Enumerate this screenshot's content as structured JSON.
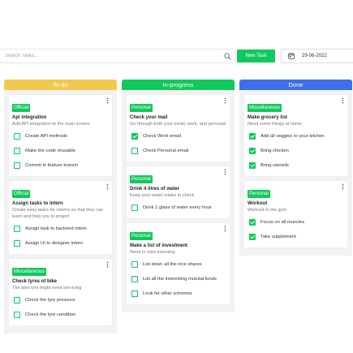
{
  "toolbar": {
    "search_placeholder": "Search Tasks...",
    "new_task_label": "New Task",
    "date_value": "29-06-2022"
  },
  "colors": {
    "todo": "#f2c94c",
    "inprogress": "#10c95a",
    "done": "#3d6fe8",
    "tag": "#10c95a"
  },
  "columns": [
    {
      "title": "To do",
      "cards": [
        {
          "tag": "Official",
          "title": "Api integration",
          "desc": "Add API integration to the main screen",
          "tasks": [
            {
              "label": "Create API methods",
              "checked": false
            },
            {
              "label": "Make the code reusable",
              "checked": false
            },
            {
              "label": "Commit in feature branch",
              "checked": false
            }
          ]
        },
        {
          "tag": "Official",
          "title": "Assign tasks to intern",
          "desc": "Create easy tasks for interns so that they can learn and help you in project",
          "tasks": [
            {
              "label": "Assign task to backend intern",
              "checked": false
            },
            {
              "label": "Assign UI to designer intern",
              "checked": false
            }
          ]
        },
        {
          "tag": "Miscellaneous",
          "title": "Check tyres of bike",
          "desc": "The bike tyre might need servicing",
          "tasks": [
            {
              "label": "Check the tyre pressure",
              "checked": false
            },
            {
              "label": "Check the tyre condition",
              "checked": false
            }
          ]
        }
      ]
    },
    {
      "title": "In-progress",
      "cards": [
        {
          "tag": "Personal",
          "title": "Check your mail",
          "desc": "Go through both your email, work, and personal",
          "tasks": [
            {
              "label": "Check Work email",
              "checked": true
            },
            {
              "label": "Check Personal email",
              "checked": false
            }
          ]
        },
        {
          "tag": "Personal",
          "title": "Drink 4 litres of water",
          "desc": "Keep your water intake in check",
          "tasks": [
            {
              "label": "Drink 1 glass of water every hour",
              "checked": false
            }
          ]
        },
        {
          "tag": "Personal",
          "title": "Make a list of investment",
          "desc": "Need to start investing",
          "tasks": [
            {
              "label": "List down all the nice shares",
              "checked": false
            },
            {
              "label": "List all the interesting mututal funds",
              "checked": false
            },
            {
              "label": "Look for other schemes",
              "checked": false
            }
          ]
        }
      ]
    },
    {
      "title": "Done",
      "cards": [
        {
          "tag": "Miscellaneous",
          "title": "Make grocery list",
          "desc": "Need some things at home",
          "tasks": [
            {
              "label": "Add all veggies to your kitchen",
              "checked": true
            },
            {
              "label": "Bring chicken",
              "checked": true
            },
            {
              "label": "Bring utensils",
              "checked": true
            }
          ]
        },
        {
          "tag": "Personal",
          "title": "Workout",
          "desc": "Workout in the gym",
          "tasks": [
            {
              "label": "Focus on all muscles",
              "checked": true
            },
            {
              "label": "Take supplement",
              "checked": true
            }
          ]
        }
      ]
    }
  ]
}
